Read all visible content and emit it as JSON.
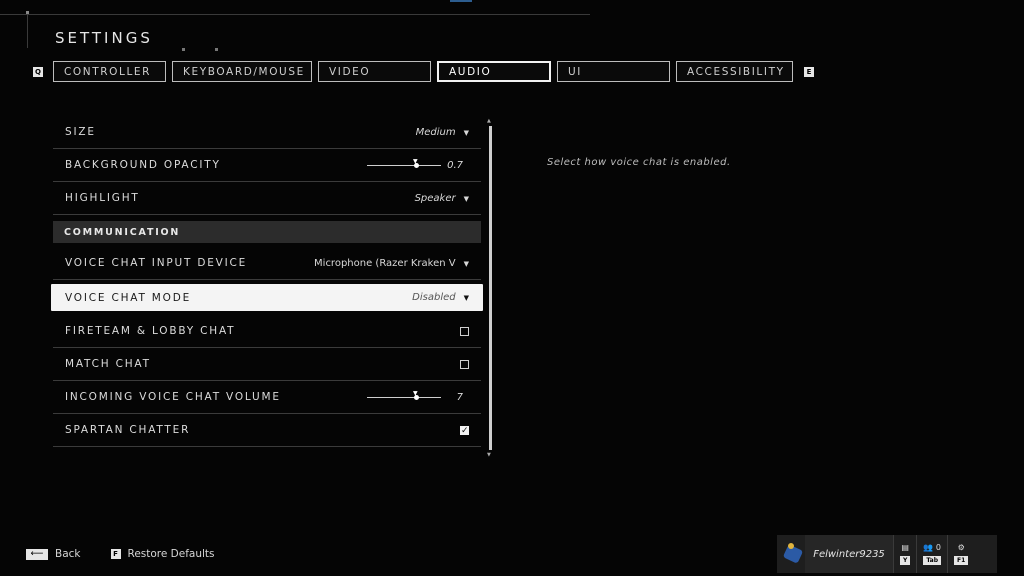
{
  "title": "SETTINGS",
  "keyhints": {
    "left": "Q",
    "right": "E"
  },
  "tabs": [
    {
      "label": "CONTROLLER",
      "active": false
    },
    {
      "label": "KEYBOARD/MOUSE",
      "active": false
    },
    {
      "label": "VIDEO",
      "active": false
    },
    {
      "label": "AUDIO",
      "active": true
    },
    {
      "label": "UI",
      "active": false
    },
    {
      "label": "ACCESSIBILITY",
      "active": false
    }
  ],
  "settings": {
    "size": {
      "label": "SIZE",
      "value": "Medium"
    },
    "background_opacity": {
      "label": "BACKGROUND OPACITY",
      "value": "0.7",
      "level": 0.7
    },
    "highlight": {
      "label": "HIGHLIGHT",
      "value": "Speaker"
    },
    "communication_section": "COMMUNICATION",
    "voice_chat_input_device": {
      "label": "VOICE CHAT INPUT DEVICE",
      "value": "Microphone (Razer Kraken V"
    },
    "voice_chat_mode": {
      "label": "VOICE CHAT MODE",
      "value": "Disabled"
    },
    "fireteam_lobby_chat": {
      "label": "FIRETEAM & LOBBY CHAT",
      "checked": false
    },
    "match_chat": {
      "label": "MATCH CHAT",
      "checked": false
    },
    "incoming_voice_chat_volume": {
      "label": "INCOMING VOICE CHAT VOLUME",
      "value": "7",
      "level": 0.7
    },
    "spartan_chatter": {
      "label": "SPARTAN CHATTER",
      "checked": true
    }
  },
  "description": "Select how voice chat is enabled.",
  "footer": {
    "back_label": "Back",
    "restore_key": "F",
    "restore_label": "Restore Defaults"
  },
  "user": {
    "gamertag": "Felwinter9235",
    "chat_key": "Y",
    "friends_count": "0",
    "friends_key": "Tab",
    "settings_key": "F1"
  },
  "icons": {
    "back": "arrow-left-icon",
    "chat": "chat-bubble-icon",
    "friends": "people-icon",
    "settings": "gear-icon"
  }
}
